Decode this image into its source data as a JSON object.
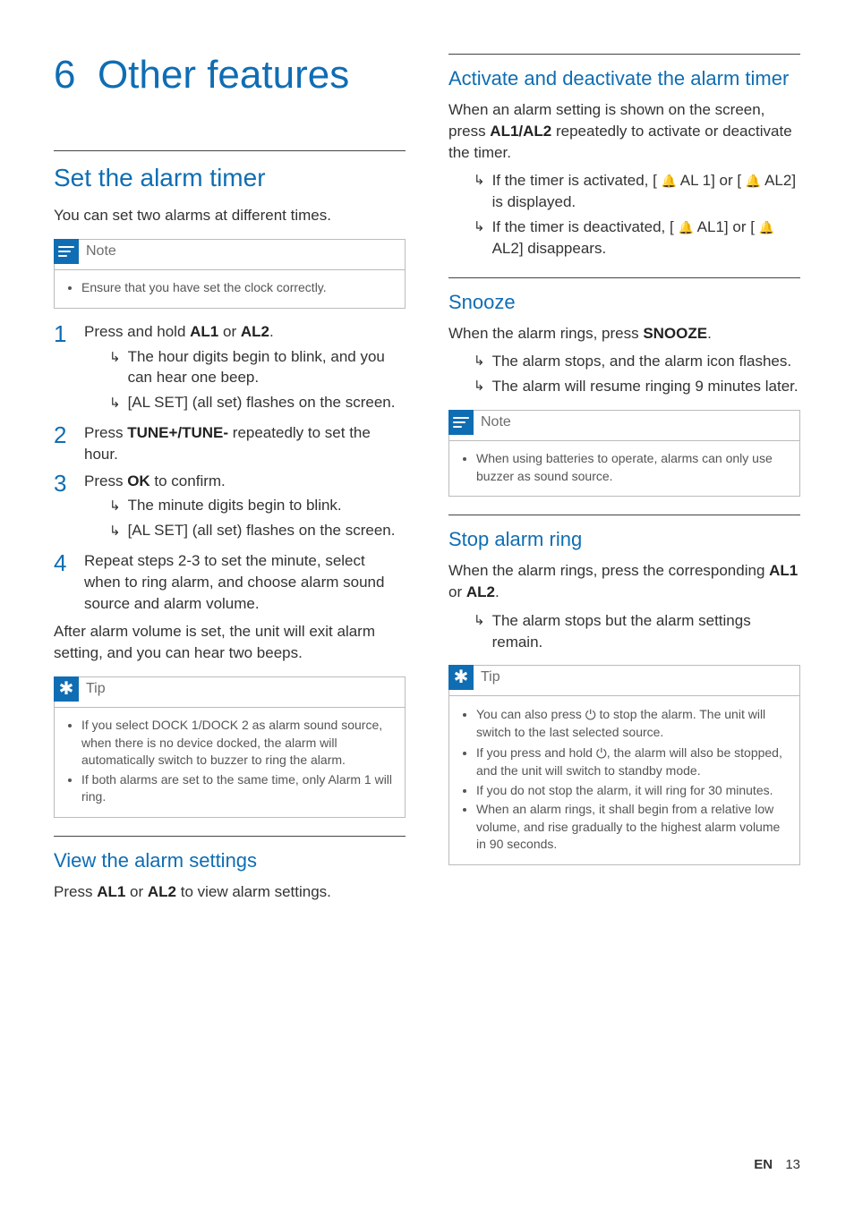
{
  "chapter": {
    "number": "6",
    "title": "Other features"
  },
  "left": {
    "h2_set_alarm": "Set the alarm timer",
    "intro": "You can set two alarms at different times.",
    "note1_title": "Note",
    "note1_item": "Ensure that you have set the clock correctly.",
    "step1_a": "Press and hold ",
    "step1_al1": "AL1",
    "step1_or": " or ",
    "step1_al2": "AL2",
    "step1_end": ".",
    "step1_sub1": "The hour digits begin to blink, and you can hear one beep.",
    "step1_sub2": "[AL SET] (all set) flashes on the screen.",
    "step2_a": "Press ",
    "step2_tune": "TUNE+/TUNE-",
    "step2_b": " repeatedly to set the hour.",
    "step3_a": "Press ",
    "step3_ok": "OK",
    "step3_b": " to confirm.",
    "step3_sub1": "The minute digits begin to blink.",
    "step3_sub2": "[AL SET] (all set) flashes on the screen.",
    "step4": "Repeat steps 2-3 to set the minute, select when to ring alarm, and choose alarm sound source and alarm volume.",
    "after": "After alarm volume is set, the unit will exit alarm setting, and you can hear two beeps.",
    "tip1_title": "Tip",
    "tip1_item1": "If you select DOCK 1/DOCK 2 as alarm sound source, when there is no device docked, the alarm will automatically switch to buzzer to ring the alarm.",
    "tip1_item2": "If both alarms are set to the same time, only Alarm 1 will ring.",
    "h3_view": "View the alarm settings",
    "view_a": "Press ",
    "view_al1": "AL1",
    "view_or": " or ",
    "view_al2": "AL2",
    "view_b": " to view alarm settings."
  },
  "right": {
    "h3_activate": "Activate and deactivate the alarm timer",
    "act_a": "When an alarm setting is shown on the screen, press ",
    "act_al": "AL1/AL2",
    "act_b": " repeatedly to activate or deactivate the timer.",
    "act_sub1_a": "If the timer is activated, [ ",
    "act_sub1_b": " AL 1] or [ ",
    "act_sub1_c": " AL2] is displayed.",
    "act_sub2_a": "If the timer is deactivated, [ ",
    "act_sub2_b": " AL1] or [ ",
    "act_sub2_c": " AL2] disappears.",
    "h3_snooze": "Snooze",
    "sn_a": "When the alarm rings, press ",
    "sn_snooze": "SNOOZE",
    "sn_b": ".",
    "sn_sub1": "The alarm stops, and the alarm icon flashes.",
    "sn_sub2": "The alarm will resume ringing 9 minutes later.",
    "note2_title": "Note",
    "note2_item": "When using batteries to operate, alarms can only use buzzer as sound source.",
    "h3_stop": "Stop alarm ring",
    "stop_a": "When the alarm rings, press the corresponding ",
    "stop_al1": "AL1",
    "stop_or": " or ",
    "stop_al2": "AL2",
    "stop_b": ".",
    "stop_sub1": "The alarm stops but the alarm settings remain.",
    "tip2_title": "Tip",
    "tip2_item1_a": "You can also press ",
    "tip2_item1_b": " to stop the alarm. The unit will switch to the last selected source.",
    "tip2_item2_a": "If you press and hold ",
    "tip2_item2_b": ", the alarm will also be stopped, and the unit will switch to standby mode.",
    "tip2_item3": "If you do not stop the alarm, it will ring for 30 minutes.",
    "tip2_item4": "When an alarm rings, it shall begin from a relative low volume, and rise gradually to the highest alarm volume in 90 seconds."
  },
  "footer": {
    "lang": "EN",
    "page": "13"
  },
  "icons": {
    "bell": "🔔",
    "power": "⏻"
  }
}
